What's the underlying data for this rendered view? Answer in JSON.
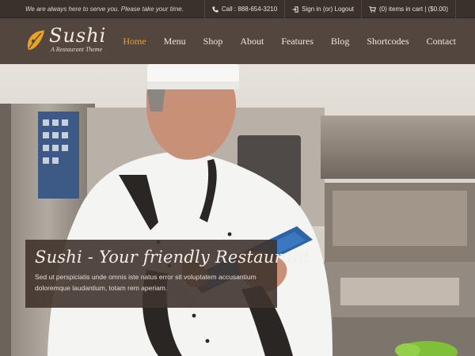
{
  "topbar": {
    "tagline": "We are always here to serve you. Please take your time.",
    "links": [
      {
        "icon": "phone-icon",
        "label": "Call : 888-654-3210"
      },
      {
        "icon": "sign-in-icon",
        "label": "Sign in (or) Logout"
      },
      {
        "icon": "cart-icon",
        "label": "(0) items in cart | ($0.00)"
      }
    ]
  },
  "header": {
    "logo_title": "Sushi",
    "logo_subtitle": "A Restaurant Theme",
    "nav": [
      "Home",
      "Menu",
      "Shop",
      "About",
      "Features",
      "Blog",
      "Shortcodes",
      "Contact"
    ],
    "active_nav": "Home"
  },
  "hero": {
    "caption_title": "Sushi - Your friendly Restaurant",
    "caption_text": "Sed ut perspiciatis unde omnis iste natus error sit voluptatem accusantium doloremque laudantium, totam rem aperiam."
  },
  "colors": {
    "accent": "#e9a226",
    "header_bg": "#53463e",
    "topbar_bg": "#3b312c",
    "caption_bg": "#40342e"
  }
}
